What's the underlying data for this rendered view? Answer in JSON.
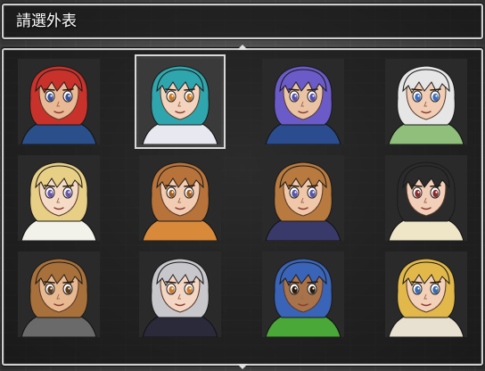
{
  "window": {
    "title": "請選外表"
  },
  "faces": [
    {
      "name": "red-hair-warrior",
      "selected": false,
      "hair": "#c8322a",
      "skin": "#e9b894",
      "eye": "#3a4f9a",
      "cloth": "#2a4f8a",
      "bg": "#2a2a2a"
    },
    {
      "name": "teal-hair-girl",
      "selected": true,
      "hair": "#2fa6ad",
      "skin": "#f3d3bd",
      "eye": "#c9741c",
      "cloth": "#e8e8f0",
      "bg": "#3a3a3a"
    },
    {
      "name": "purple-hair-knight",
      "selected": false,
      "hair": "#6a5bc8",
      "skin": "#eac3a4",
      "eye": "#5a4bb0",
      "cloth": "#2b4d8f",
      "bg": "#2a2a2a"
    },
    {
      "name": "white-hair-elder",
      "selected": false,
      "hair": "#e6e6e6",
      "skin": "#f0cdb4",
      "eye": "#3a6dc4",
      "cloth": "#8fbf7a",
      "bg": "#2a2a2a"
    },
    {
      "name": "blonde-priestess",
      "selected": false,
      "hair": "#e8cf86",
      "skin": "#f5dbc6",
      "eye": "#6a56a8",
      "cloth": "#f2f2ea",
      "bg": "#2a2a2a"
    },
    {
      "name": "brown-hair-beastgirl",
      "selected": false,
      "hair": "#b8733a",
      "skin": "#f1ccb2",
      "eye": "#a45d1e",
      "cloth": "#d88a3a",
      "bg": "#2a2a2a"
    },
    {
      "name": "brown-hair-boy",
      "selected": false,
      "hair": "#b87a3e",
      "skin": "#f0c7a8",
      "eye": "#5a55a8",
      "cloth": "#3a3a6a",
      "bg": "#2a2a2a"
    },
    {
      "name": "dark-hair-glasses-woman",
      "selected": false,
      "hair": "#2b2b2b",
      "skin": "#f2cfb8",
      "eye": "#8a2c2c",
      "cloth": "#efe6c8",
      "bg": "#2a2a2a"
    },
    {
      "name": "brown-hair-tattoo-youth",
      "selected": false,
      "hair": "#a8703a",
      "skin": "#e8b890",
      "eye": "#5a3a1a",
      "cloth": "#6a6a6a",
      "bg": "#2a2a2a"
    },
    {
      "name": "silver-hair-flower-girl",
      "selected": false,
      "hair": "#c8c8cc",
      "skin": "#f4d6c4",
      "eye": "#d07a2a",
      "cloth": "#2a2a3a",
      "bg": "#2a2a2a"
    },
    {
      "name": "blue-hair-bandana-man",
      "selected": false,
      "hair": "#3a64b8",
      "skin": "#a8724a",
      "eye": "#2a1a0a",
      "cloth": "#4aa838",
      "bg": "#2a2a2a"
    },
    {
      "name": "blonde-hair-woman",
      "selected": false,
      "hair": "#e2b84a",
      "skin": "#f3d1b8",
      "eye": "#3a6ab0",
      "cloth": "#e8e0d0",
      "bg": "#2a2a2a"
    }
  ]
}
